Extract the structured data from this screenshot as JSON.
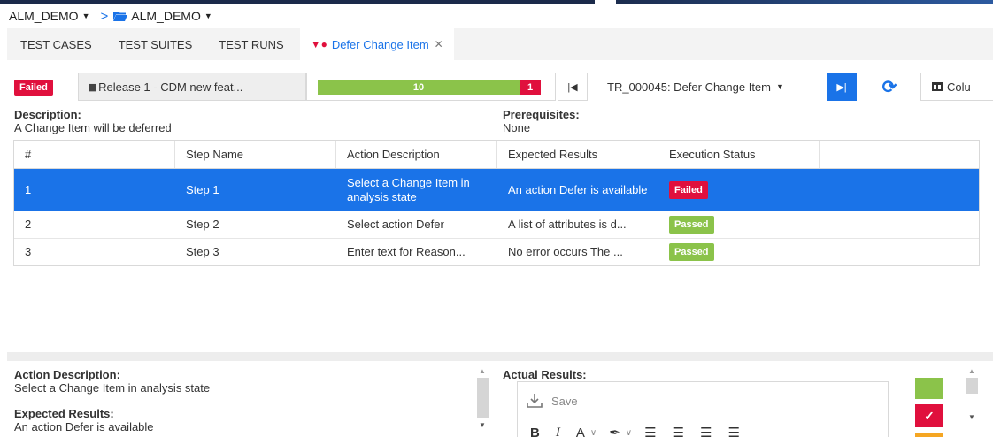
{
  "breadcrumb": {
    "project": "ALM_DEMO",
    "folder": "ALM_DEMO"
  },
  "tabs": [
    {
      "label": "TEST CASES"
    },
    {
      "label": "TEST SUITES"
    },
    {
      "label": "TEST RUNS"
    },
    {
      "label": "Defer Change Item"
    }
  ],
  "toolbar": {
    "status": "Failed",
    "release": "Release 1 - CDM new feat...",
    "progress": {
      "passed": "10",
      "failed": "1",
      "passed_count": 10,
      "failed_count": 1
    },
    "test_run": "TR_000045: Defer Change Item",
    "columns_label": "Colu"
  },
  "description": {
    "label": "Description:",
    "text": "A Change Item will be deferred"
  },
  "prerequisites": {
    "label": "Prerequisites:",
    "text": "None"
  },
  "grid": {
    "columns": [
      "#",
      "Step Name",
      "Action Description",
      "Expected Results",
      "Execution Status"
    ],
    "rows": [
      {
        "num": "1",
        "step": "Step 1",
        "action": "Select a Change Item in analysis state",
        "expected": "An action Defer is available",
        "status": "Failed"
      },
      {
        "num": "2",
        "step": "Step 2",
        "action": "Select action Defer",
        "expected": "A list of attributes is d...",
        "status": "Passed"
      },
      {
        "num": "3",
        "step": "Step 3",
        "action": "Enter text for Reason...",
        "expected": "No error occurs The ...",
        "status": "Passed"
      }
    ]
  },
  "detail": {
    "action_label": "Action Description:",
    "action_text": "Select a Change Item in analysis state",
    "expected_label": "Expected Results:",
    "expected_text": "An action Defer is available",
    "actual_label": "Actual Results:",
    "save_label": "Save"
  },
  "colors": {
    "accent": "#1a73e8",
    "failed": "#e0103d",
    "passed": "#8bc34a",
    "warning": "#f5a623"
  }
}
